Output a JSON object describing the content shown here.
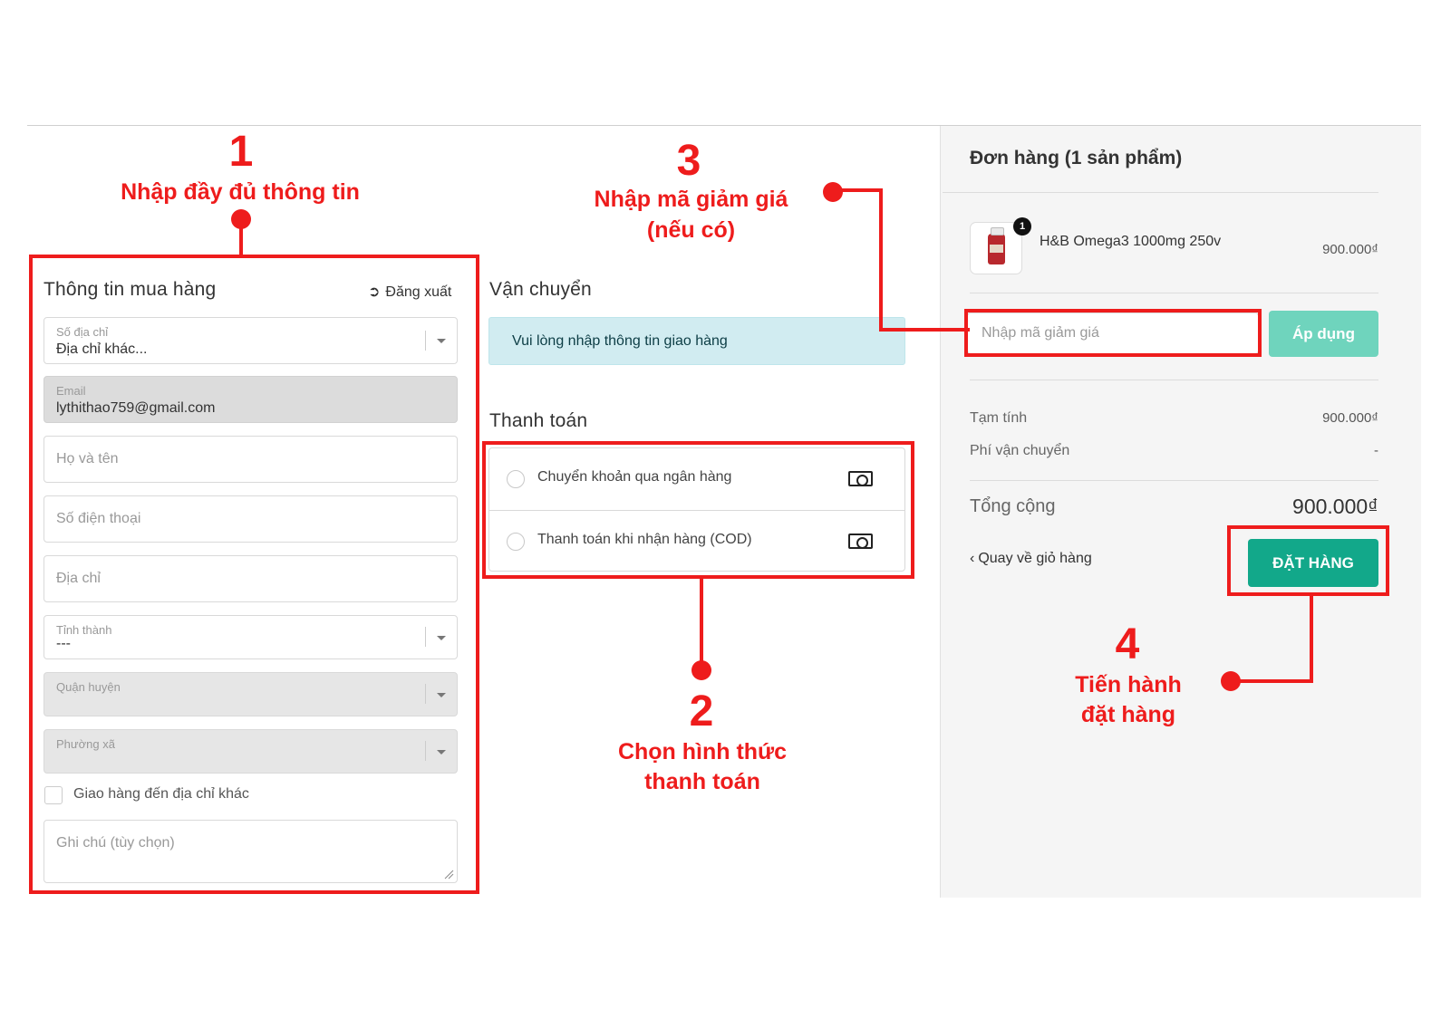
{
  "colors": {
    "accent_red": "#ee1c1c",
    "primary_button": "#12a88a",
    "apply_button": "#6fd4bd",
    "info_background": "#d1ecf1",
    "summary_background": "#f5f5f5"
  },
  "billing": {
    "title": "Thông tin mua hàng",
    "logout_label": "Đăng xuất",
    "address_select_label": "Số địa chỉ",
    "address_select_value": "Địa chỉ khác...",
    "email_label": "Email",
    "email_value": "lythithao759@gmail.com",
    "name_placeholder": "Họ và tên",
    "phone_placeholder": "Số điện thoại",
    "address_placeholder": "Địa chỉ",
    "province_label": "Tỉnh thành",
    "province_value": "---",
    "district_label": "Quận huyện",
    "ward_label": "Phường xã",
    "ship_other_label": "Giao hàng đến địa chỉ khác",
    "note_placeholder": "Ghi chú (tùy chọn)"
  },
  "shipping": {
    "title": "Vận chuyển",
    "info": "Vui lòng nhập thông tin giao hàng"
  },
  "payment": {
    "title": "Thanh toán",
    "options": [
      {
        "label": "Chuyển khoản qua ngân hàng",
        "icon": "money-icon"
      },
      {
        "label": "Thanh toán khi nhận hàng (COD)",
        "icon": "money-icon"
      }
    ]
  },
  "summary": {
    "title": "Đơn hàng (1 sản phẩm)",
    "product": {
      "name": "H&B Omega3 1000mg 250v",
      "price": "900.000₫",
      "quantity": "1"
    },
    "discount_placeholder": "Nhập mã giảm giá",
    "apply_label": "Áp dụng",
    "subtotal_label": "Tạm tính",
    "subtotal_value": "900.000₫",
    "shipping_fee_label": "Phí vận chuyển",
    "shipping_fee_value": "-",
    "total_label": "Tổng cộng",
    "total_value": "900.000₫",
    "back_label": "Quay về giỏ hàng",
    "order_label": "ĐẶT HÀNG"
  },
  "annotations": {
    "step1": {
      "number": "1",
      "text": "Nhập đầy đủ thông tin"
    },
    "step2": {
      "number": "2",
      "line1": "Chọn hình thức",
      "line2": "thanh toán"
    },
    "step3": {
      "number": "3",
      "line1": "Nhập mã giảm giá",
      "line2": "(nếu có)"
    },
    "step4": {
      "number": "4",
      "line1": "Tiến hành",
      "line2": "đặt hàng"
    }
  }
}
